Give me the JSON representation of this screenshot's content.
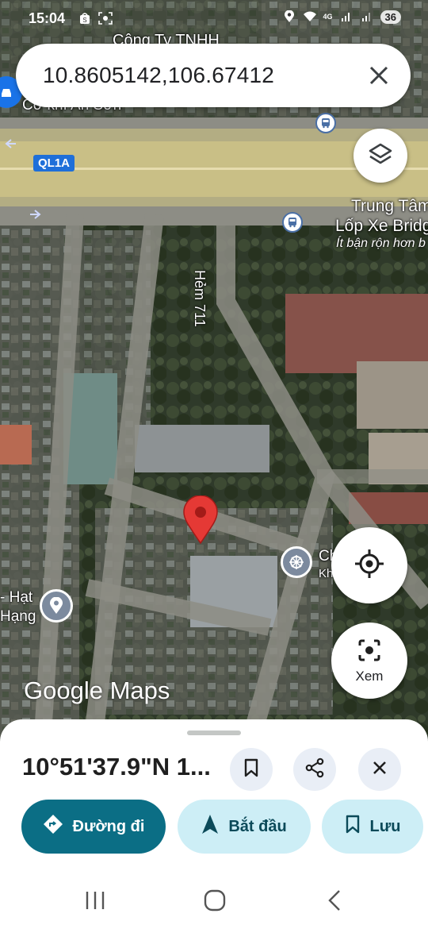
{
  "status_bar": {
    "time": "15:04",
    "network": "4G",
    "battery": "36",
    "left_icons": [
      "shopee-bag-icon",
      "screenshot-icon"
    ],
    "right_icons": [
      "location-icon",
      "wifi-icon",
      "signal-icon",
      "signal-icon"
    ]
  },
  "search": {
    "query": "10.8605142,106.67412",
    "close_icon": "close-icon"
  },
  "map": {
    "labels": {
      "company": "Công Ty TNHH",
      "company_2": "Cơ khí An Sơn",
      "highway": "QL1A",
      "tire_center_1": "Trung Tâm",
      "tire_center_2": "Lốp Xe Bridg",
      "tire_center_busy": "Ít bận rộn hơn b",
      "alley": "Hẻm 711",
      "poi_right_1": "Ch      n Xu",
      "poi_right_2": "Kh            rộn",
      "poi_left_1": "- Hạt",
      "poi_left_2": "Hạng"
    },
    "watermark": "Google Maps",
    "colors": {
      "pin": "#e53935",
      "road": "#8d8d85",
      "highway": "#c9bf86",
      "accent": "#0b6e85"
    }
  },
  "controls": {
    "layers_icon": "layers-icon",
    "locate_icon": "my-location-icon",
    "lens_label": "Xem"
  },
  "sheet": {
    "title": "10°51'37.9\"N 1...",
    "actions": [
      "bookmark-icon",
      "share-icon",
      "close-icon"
    ],
    "buttons": {
      "directions": "Đường đi",
      "start": "Bắt đầu",
      "save": "Lưu"
    }
  },
  "navbar": {
    "items": [
      "recent-apps-icon",
      "home-icon",
      "back-icon"
    ]
  }
}
